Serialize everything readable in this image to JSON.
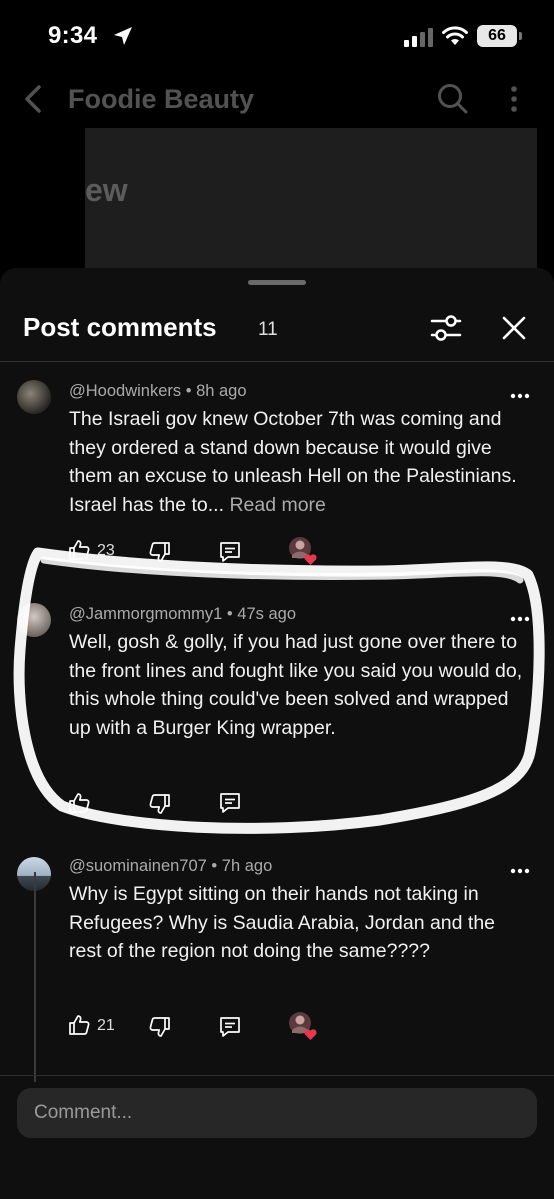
{
  "status_bar": {
    "time": "9:34",
    "battery": "66"
  },
  "app_bar": {
    "title": "Foodie Beauty"
  },
  "video_preview": {
    "text": "ew"
  },
  "sheet": {
    "title": "Post comments",
    "count": "11"
  },
  "comments": [
    {
      "meta": "@Hoodwinkers • 8h ago",
      "text": "The Israeli gov knew October 7th was coming and they ordered a stand down because it would give them an excuse to unleash Hell on the Palestinians. Israel has the to...",
      "read_more": "Read more",
      "likes": "23"
    },
    {
      "meta": "@Jammorgmommy1 • 47s ago",
      "text": "Well, gosh & golly, if you had just gone over there to the front lines and fought like you said you would do, this whole thing could've been solved and wrapped up with a Burger King wrapper."
    },
    {
      "meta": "@suominainen707 • 7h ago",
      "text": "Why is Egypt sitting on their hands not taking in Refugees?  Why is Saudia Arabia, Jordan and the rest of the region not doing the same????",
      "likes": "21"
    }
  ],
  "composer": {
    "placeholder": "Comment..."
  },
  "colors": {
    "sheet_bg": "#0f0f0f",
    "highlight": "#ffffff",
    "heart": "#e53950"
  }
}
